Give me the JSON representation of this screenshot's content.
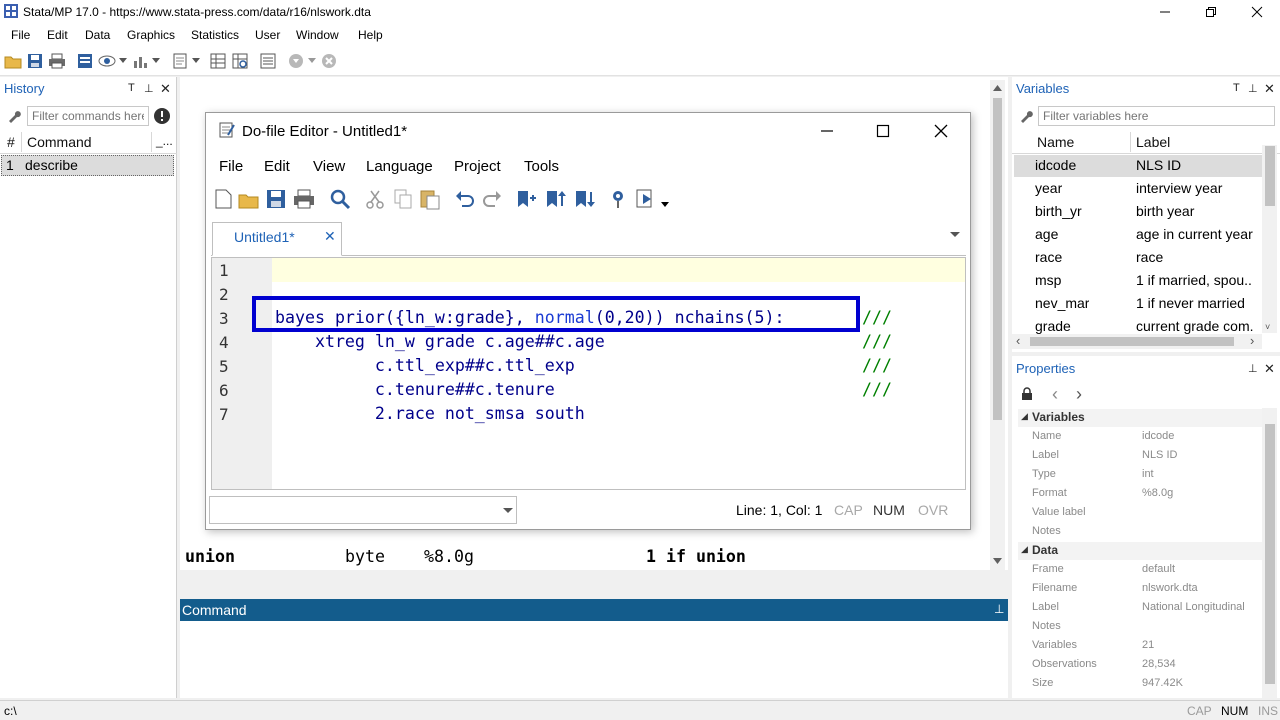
{
  "app": {
    "title": "Stata/MP 17.0 - https://www.stata-press.com/data/r16/nlswork.dta",
    "menus": [
      "File",
      "Edit",
      "Data",
      "Graphics",
      "Statistics",
      "User",
      "Window",
      "Help"
    ]
  },
  "history": {
    "title": "History",
    "filter_placeholder": "Filter commands here",
    "col_num": "#",
    "col_command": "Command",
    "col_rc": "_...",
    "items": [
      {
        "num": "1",
        "command": "describe"
      }
    ]
  },
  "results": {
    "row_name": "union",
    "row_type": "byte",
    "row_format": "%8.0g",
    "row_label": "1 if union"
  },
  "command": {
    "title": "Command"
  },
  "editor": {
    "title": "Do-file Editor - Untitled1*",
    "menus": [
      "File",
      "Edit",
      "View",
      "Language",
      "Project",
      "Tools"
    ],
    "tab": "Untitled1*",
    "line_numbers": [
      "1",
      "2",
      "3",
      "4",
      "5",
      "6",
      "7"
    ],
    "code": {
      "l3_a": "bayes prior({ln_w:grade}, ",
      "l3_fn": "normal",
      "l3_b": "(0,20)) nchains(5):",
      "l4_kw": "    xtreg",
      "l4_b": " ln_w grade c.age##c.age",
      "l5": "          c.ttl_exp##c.ttl_exp",
      "l6": "          c.tenure##c.tenure",
      "l7": "          2.race not_smsa south",
      "cont": "///"
    },
    "status": {
      "position": "Line: 1, Col: 1",
      "cap": "CAP",
      "num": "NUM",
      "ovr": "OVR"
    },
    "highlight_color": "#0000d0"
  },
  "variables": {
    "title": "Variables",
    "filter_placeholder": "Filter variables here",
    "col_name": "Name",
    "col_label": "Label",
    "rows": [
      {
        "name": "idcode",
        "label": "NLS ID"
      },
      {
        "name": "year",
        "label": "interview year"
      },
      {
        "name": "birth_yr",
        "label": "birth year"
      },
      {
        "name": "age",
        "label": "age in current year"
      },
      {
        "name": "race",
        "label": "race"
      },
      {
        "name": "msp",
        "label": "1 if married, spou.."
      },
      {
        "name": "nev_mar",
        "label": "1 if never married"
      },
      {
        "name": "grade",
        "label": "current grade com."
      }
    ]
  },
  "properties": {
    "title": "Properties",
    "sections": [
      {
        "title": "Variables",
        "rows": [
          {
            "name": "Name",
            "value": "idcode"
          },
          {
            "name": "Label",
            "value": "NLS ID"
          },
          {
            "name": "Type",
            "value": "int"
          },
          {
            "name": "Format",
            "value": "%8.0g"
          },
          {
            "name": "Value label",
            "value": ""
          },
          {
            "name": "Notes",
            "value": ""
          }
        ]
      },
      {
        "title": "Data",
        "rows": [
          {
            "name": "Frame",
            "value": "default"
          },
          {
            "name": "Filename",
            "value": "nlswork.dta"
          },
          {
            "name": "Label",
            "value": "National Longitudinal"
          },
          {
            "name": "Notes",
            "value": ""
          },
          {
            "name": "Variables",
            "value": "21"
          },
          {
            "name": "Observations",
            "value": "28,534"
          },
          {
            "name": "Size",
            "value": "947.42K"
          }
        ]
      }
    ]
  },
  "statusbar": {
    "path": "c:\\",
    "cap": "CAP",
    "num": "NUM",
    "ins": "INS"
  }
}
